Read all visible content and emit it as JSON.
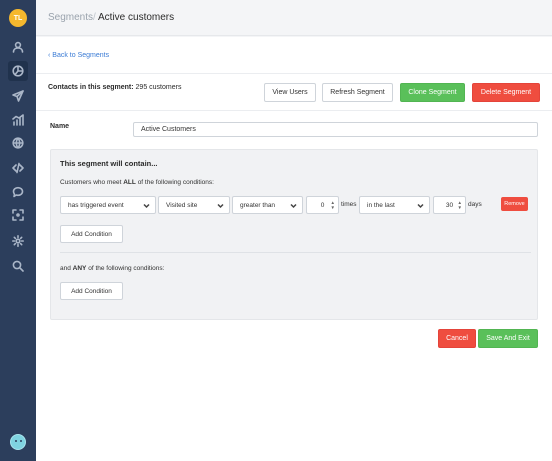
{
  "sidebar": {
    "logo_text": "TL",
    "nav_icons": [
      "user-icon",
      "segments-icon",
      "send-icon",
      "chart-icon",
      "globe-icon",
      "code-icon",
      "chat-icon",
      "expand-icon",
      "gear-icon",
      "search-icon"
    ],
    "active_index": 1
  },
  "breadcrumb": {
    "parent": "Segments",
    "separator": "/",
    "current": "Active customers"
  },
  "back_link": "‹  Back to Segments",
  "contacts": {
    "label": "Contacts in this segment:",
    "value": "295 customers"
  },
  "actions": {
    "view_users": "View Users",
    "refresh": "Refresh Segment",
    "clone": "Clone Segment",
    "delete": "Delete Segment"
  },
  "name_field": {
    "label": "Name",
    "value": "Active Customers"
  },
  "segment": {
    "title": "This segment will contain...",
    "all_group": {
      "prefix": "Customers who meet",
      "keyword": "ALL",
      "suffix": "of the following conditions:"
    },
    "condition": {
      "event_type": "has triggered event",
      "event_name": "Visited site",
      "comparator": "greater than",
      "count": "0",
      "count_unit": "times",
      "time_window": "in the last",
      "duration": "30",
      "duration_unit": "days",
      "remove_label": "Remove"
    },
    "add_condition_label": "Add Condition",
    "any_group": {
      "prefix": "and",
      "keyword": "ANY",
      "suffix": "of the following conditions:"
    }
  },
  "footer": {
    "cancel": "Cancel",
    "save": "Save And Exit"
  },
  "colors": {
    "sidebar": "#2c3e5c",
    "accent_green": "#5ac05a",
    "accent_red": "#ef4d3f",
    "link": "#3a7bd5"
  }
}
